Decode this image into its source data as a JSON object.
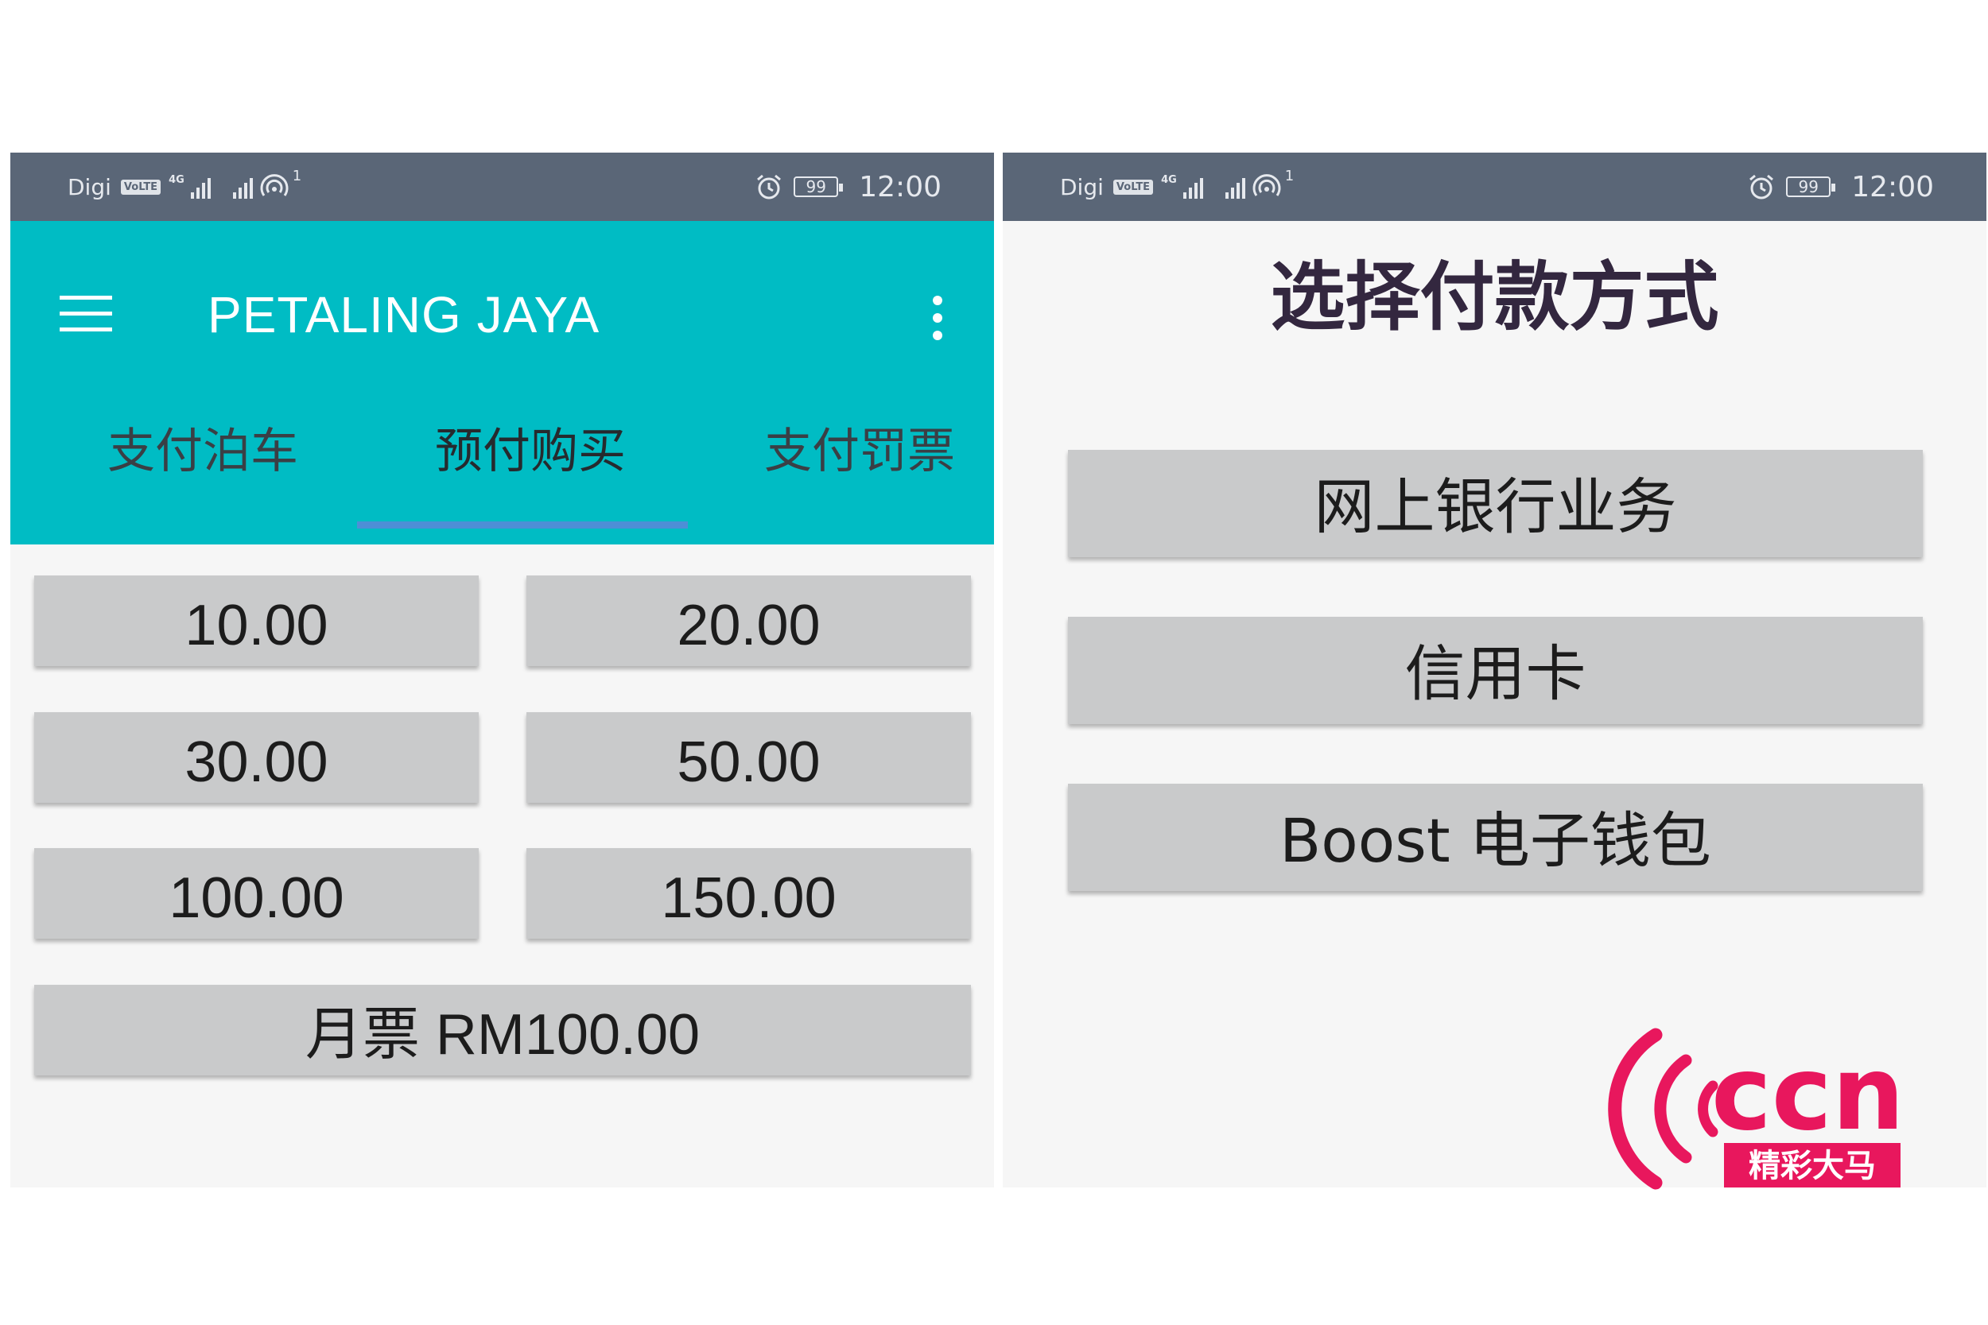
{
  "status_bar": {
    "carrier": "Digi",
    "volte": "VoLTE",
    "network": "4G",
    "sim_index": "1",
    "battery": "99",
    "time": "12:00"
  },
  "left_screen": {
    "app_title": "PETALING JAYA",
    "tabs": [
      {
        "label": "支付泊车",
        "active": false
      },
      {
        "label": "预付购买",
        "active": true
      },
      {
        "label": "支付罚票",
        "active": false
      }
    ],
    "amounts": [
      "10.00",
      "20.00",
      "30.00",
      "50.00",
      "100.00",
      "150.00"
    ],
    "monthly_pass": "月票 RM100.00"
  },
  "right_screen": {
    "title": "选择付款方式",
    "options": [
      "网上银行业务",
      "信用卡",
      "Boost 电子钱包"
    ]
  },
  "logo": {
    "text": "ccn",
    "tagline": "精彩大马",
    "color": "#e8175d"
  },
  "colors": {
    "status_bar": "#5a6677",
    "app_bar": "#00bcc4",
    "tab_indicator": "#4d8fd6",
    "button": "#c9cacb",
    "title": "#33273f"
  }
}
